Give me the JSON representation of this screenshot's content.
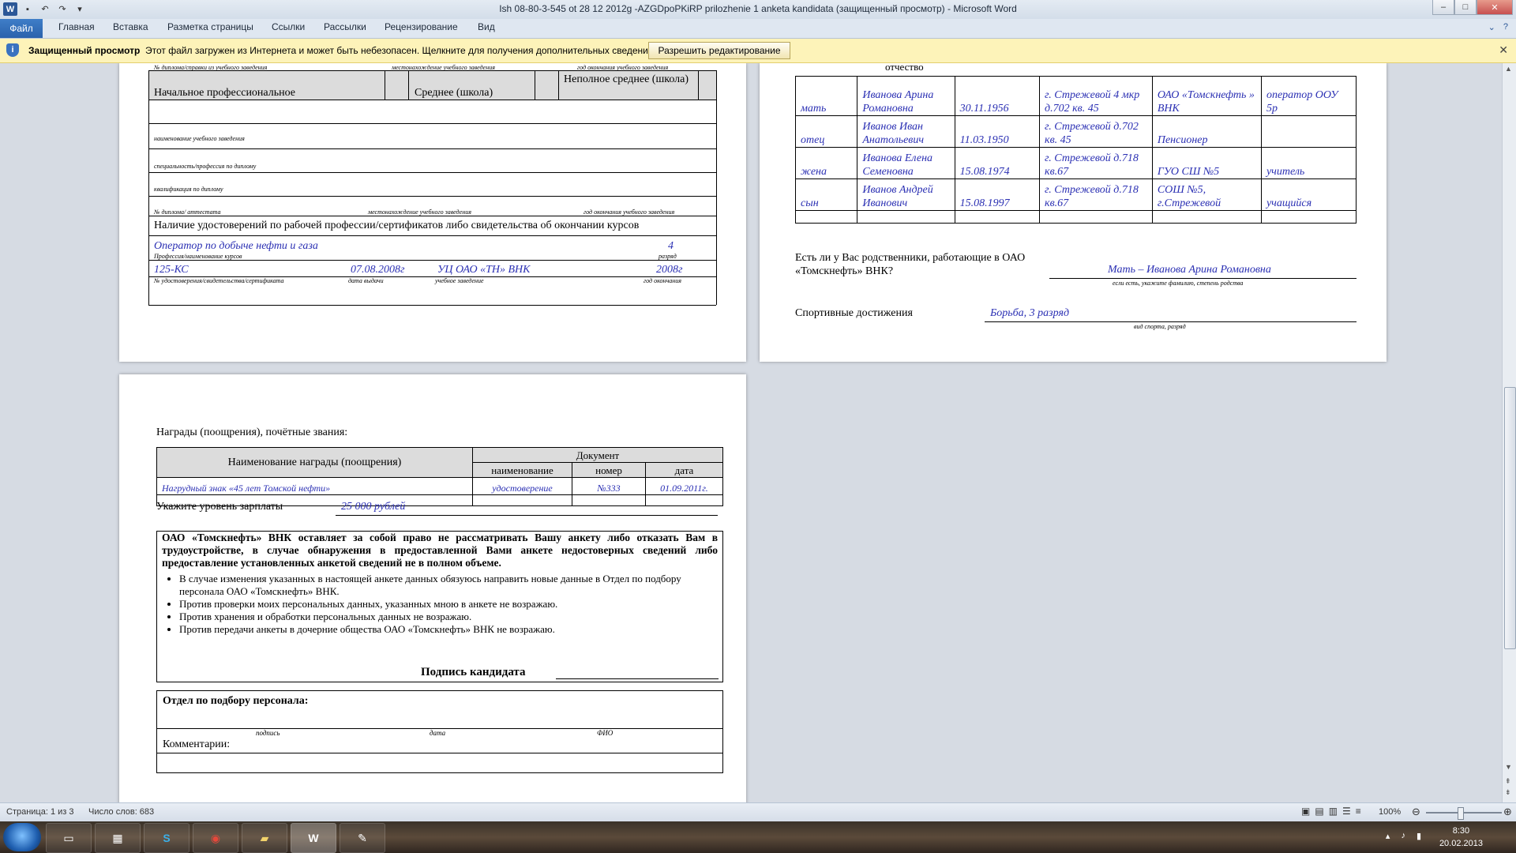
{
  "window": {
    "title": "Ish 08-80-3-545 ot 28 12 2012g -AZGDpoPKiRP prilozhenie 1 anketa kandidata (защищенный просмотр) - Microsoft Word"
  },
  "ribbon": {
    "tabs": [
      "Файл",
      "Главная",
      "Вставка",
      "Разметка страницы",
      "Ссылки",
      "Рассылки",
      "Рецензирование",
      "Вид"
    ]
  },
  "protected_view": {
    "title": "Защищенный просмотр",
    "message": "Этот файл загружен из Интернета и может быть небезопасен. Щелкните для получения дополнительных сведений.",
    "button": "Разрешить редактирование"
  },
  "page1": {
    "top_caption": "№ диплома/справки из учебного заведения",
    "top_caption2": "местонахождение учебного заведения",
    "top_caption3": "год окончания учебного заведения",
    "edu_row": [
      "Начальное профессиональное",
      "Среднее (школа)",
      "Неполное среднее (школа)"
    ],
    "captions": [
      "наименование учебного заведения",
      "специальность/профессия по диплому",
      "квалификация по диплому"
    ],
    "bottom_caption": [
      "№ диплома/ аттестата",
      "местонахождение учебного заведения",
      "год окончания учебного заведения"
    ],
    "certs_heading": "Наличие удостоверений по рабочей профессии/сертификатов либо свидетельства об окончании курсов",
    "cert_profession": "Оператор по добыче нефти и газа",
    "cert_grade": "4",
    "cert_profession_caption": "Профессия/наименование курсов",
    "cert_grade_caption": "разряд",
    "cert_number": "125-КС",
    "cert_date": "07.08.2008г",
    "cert_school": "УЦ ОАО «ТН» ВНК",
    "cert_year": "2008г",
    "cert_captions": [
      "№ удостоверения/свидетельства/сертификата",
      "дата выдачи",
      "учебное заведение",
      "год окончания"
    ]
  },
  "page2": {
    "header_fragment": "отчество",
    "relatives": [
      {
        "rel": "мать",
        "name": "Иванова Арина Романовна",
        "dob": "30.11.1956",
        "addr": "г. Стрежевой 4 мкр д.702 кв. 45",
        "work": "ОАО «Томскнефть » ВНК",
        "pos": "оператор ООУ 5р"
      },
      {
        "rel": "отец",
        "name": "Иванов Иван Анатольевич",
        "dob": "11.03.1950",
        "addr": "г. Стрежевой д.702 кв. 45",
        "work": "Пенсионер",
        "pos": ""
      },
      {
        "rel": "жена",
        "name": "Иванова Елена Семеновна",
        "dob": "15.08.1974",
        "addr": "г. Стрежевой д.718 кв.67",
        "work": "ГУО СШ №5",
        "pos": "учитель"
      },
      {
        "rel": "сын",
        "name": "Иванов Андрей Иванович",
        "dob": "15.08.1997",
        "addr": "г. Стрежевой д.718 кв.67",
        "work": "СОШ №5, г.Стрежевой",
        "pos": "учащийся"
      }
    ],
    "relatives_q": "Есть ли у Вас родственники, работающие в ОАО «Томскнефть» ВНК?",
    "relatives_a": "Мать – Иванова Арина Романовна",
    "relatives_caption": "если есть, укажите фамилию, степень родства",
    "sports_label": "Спортивные достижения",
    "sports_value": "Борьба, 3 разряд",
    "sports_caption": "вид спорта, разряд"
  },
  "page3": {
    "awards_label": "Награды (поощрения), почётные звания:",
    "awards_table": {
      "col_name": "Наименование награды (поощрения)",
      "col_doc": "Документ",
      "sub": [
        "наименование",
        "номер",
        "дата"
      ],
      "row": [
        "Нагрудный знак «45 лет Томской нефти»",
        "удостоверение",
        "№333",
        "01.09.2011г."
      ]
    },
    "salary_label": "Укажите уровень зарплаты",
    "salary_value": "25 000 рублей",
    "disclaimer": "ОАО «Томскнефть» ВНК оставляет за собой право не рассматривать Вашу анкету либо отказать Вам в трудоустройстве, в случае обнаружения в предоставленной Вами анкете недостоверных сведений либо предоставление установленных анкетой сведений не в полном объеме.",
    "bullets": [
      "В случае изменения указанных в настоящей анкете данных обязуюсь направить новые данные в Отдел по подбору персонала ОАО «Томскнефть» ВНК.",
      "Против проверки моих персональных данных, указанных мною в анкете не возражаю.",
      "Против хранения и обработки персональных данных не возражаю.",
      "Против передачи анкеты в дочерние общества ОАО «Томскнефть» ВНК не возражаю."
    ],
    "signature": "Подпись кандидата",
    "hr_heading": "Отдел по подбору персонала:",
    "hr_captions": [
      "подпись",
      "дата",
      "ФИО"
    ],
    "comments": "Комментарии:"
  },
  "statusbar": {
    "page": "Страница: 1 из 3",
    "words": "Число слов: 683",
    "zoom": "100%"
  },
  "taskbar": {
    "time": "8:30",
    "date": "20.02.2013"
  }
}
